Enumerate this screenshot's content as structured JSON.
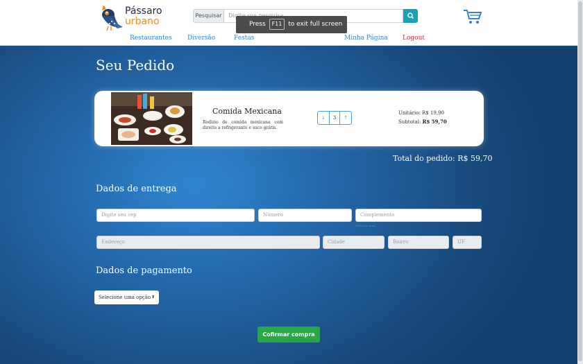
{
  "header": {
    "logo": {
      "line1": "Pássaro",
      "line2": "urbano"
    },
    "search": {
      "label": "Pesquisar",
      "placeholder": "Digite sua pesquisa"
    },
    "nav": {
      "restaurantes": "Restaurantes",
      "diversao": "Diversão",
      "festas": "Festas",
      "minha_pagina": "Minha Página",
      "logout": "Logout"
    }
  },
  "fullscreen_toast": {
    "prefix": "Press",
    "key": "F11",
    "suffix": "to exit full screen"
  },
  "order": {
    "title": "Seu Pedido",
    "item": {
      "name": "Comida Mexicana",
      "description": "Rodizio de comida mexicana com direito a refrigerante e suco grátis.",
      "quantity": "3",
      "decrement": "↓",
      "increment": "↑",
      "unit_label": "Unitário:",
      "unit_price": "R$ 19,90",
      "subtotal_label": "Subtotal:",
      "subtotal": "R$ 59,70"
    },
    "total": "Total do pedido: R$ 59,70"
  },
  "delivery": {
    "title": "Dados de entrega",
    "cep_placeholder": "Digite seu cep",
    "numero_placeholder": "Número",
    "complemento_placeholder": "Complemento",
    "complemento_hint": "Pode ser vazio",
    "endereco_placeholder": "Endereço",
    "cidade_placeholder": "Cidade",
    "bairro_placeholder": "Bairro",
    "uf_placeholder": "UF"
  },
  "payment": {
    "title": "Dados de pagamento",
    "select_value": "Selecione uma opção",
    "select_caret": "⬍"
  },
  "confirm_button": "Cofirmar compra",
  "colors": {
    "nav_link": "#2f86d6",
    "logout": "#d2233a",
    "search_button": "#17a2b8",
    "confirm_button": "#28a745",
    "logo_accent": "#f18a1c"
  }
}
